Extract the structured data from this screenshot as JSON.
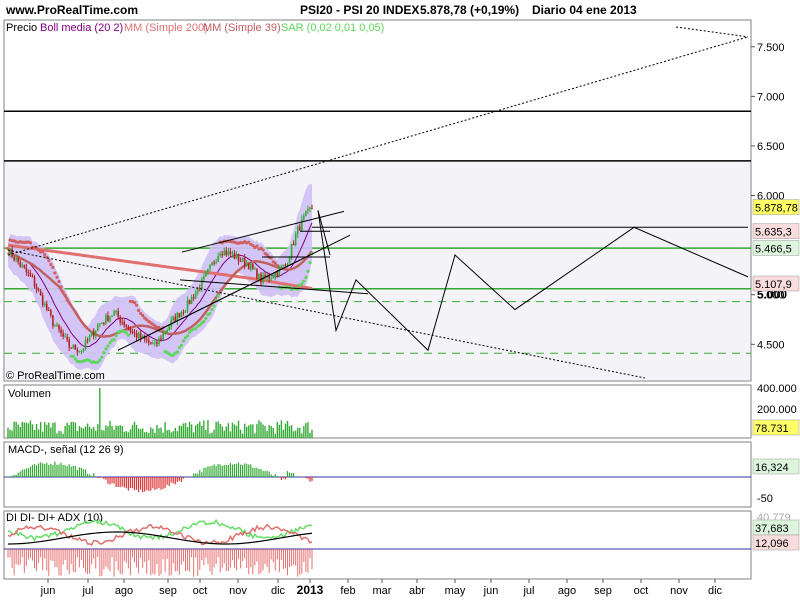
{
  "header": {
    "site": "www.ProRealTime.com",
    "instrument": "PSI20 - PSI 20 INDEX",
    "last_price": "5.878,78 (+0,19%)",
    "period": "Diario  04 ene 2013"
  },
  "colors": {
    "price_up": "#33aa33",
    "price_down": "#b22222",
    "bollinger": "#800080",
    "bollinger_fill": "#cfc0f5",
    "mm200": "#e07070",
    "mm39": "#c06060",
    "sar": "#5cd65c",
    "hline": "#33aa33",
    "volume": "#33aa33",
    "macd_pos": "#33aa33",
    "macd_neg": "#dd3333",
    "adx_line": "#000000",
    "di_plus": "#66dd66",
    "di_minus": "#e07070",
    "adx_baseline": "#3333aa",
    "value_box_green": "#ddf5dd",
    "value_box_red": "#f9dddd",
    "value_box_yellow": "#ffff66"
  },
  "chart_data": [
    {
      "type": "candlestick",
      "legend": {
        "price": "Precio",
        "boll": "Boll media (20 2)",
        "mm200": "MM (Simple 200)",
        "mm39": "MM (Simple 39)",
        "sar": "SAR (0,02 0,01 0,05)"
      },
      "y_ticks": [
        "7.500",
        "7.000",
        "6.500",
        "6.000",
        "5.000",
        "4.500"
      ],
      "y_tick_values": [
        7500,
        7000,
        6500,
        6000,
        5000,
        4500
      ],
      "ylim": [
        4130,
        7770
      ],
      "value_labels": [
        {
          "text": "5.878,78",
          "value": 5878.78,
          "style": "yellow"
        },
        {
          "text": "5.635,3",
          "value": 5635.3,
          "style": "red"
        },
        {
          "text": "5.466,5",
          "value": 5466.5,
          "style": "green"
        },
        {
          "text": "5.107,9",
          "value": 5107.9,
          "style": "red"
        }
      ],
      "bold_tick": {
        "text": "5.000",
        "value": 5000
      },
      "horizontal_lines": [
        {
          "value": 6850,
          "color": "black",
          "style": "solid"
        },
        {
          "value": 6350,
          "color": "black",
          "style": "solid"
        },
        {
          "value": 5470,
          "color": "green",
          "style": "solid"
        },
        {
          "value": 5060,
          "color": "green",
          "style": "solid"
        },
        {
          "value": 4930,
          "color": "green",
          "style": "dashed"
        },
        {
          "value": 4410,
          "color": "green",
          "style": "dashed"
        }
      ],
      "watermark": "© ProRealTime.com",
      "start_price": 5450,
      "last_close": 5878.78
    },
    {
      "type": "bar",
      "name": "Volumen",
      "y_ticks": [
        "400.000",
        "200.000"
      ],
      "value_label": "78.731",
      "last_value": 78731
    },
    {
      "type": "bar",
      "name": "MACD-, señal (12 26 9)",
      "y_ticks": [
        "-50"
      ],
      "value_label": "16,324",
      "last_value": 16.324
    },
    {
      "type": "line",
      "name": "DI DI- DI+ ADX (10)",
      "value_labels": [
        {
          "text": "37,683",
          "style": "green"
        },
        {
          "text": "12,096",
          "style": "red"
        }
      ],
      "partial_label": "40,779"
    }
  ],
  "x_axis": {
    "labels": [
      "jun",
      "jul",
      "ago",
      "sep",
      "oct",
      "nov",
      "dic",
      "2013",
      "feb",
      "mar",
      "abr",
      "may",
      "jun",
      "jul",
      "ago",
      "sep",
      "oct",
      "nov",
      "dic"
    ],
    "bold_label": "2013"
  }
}
